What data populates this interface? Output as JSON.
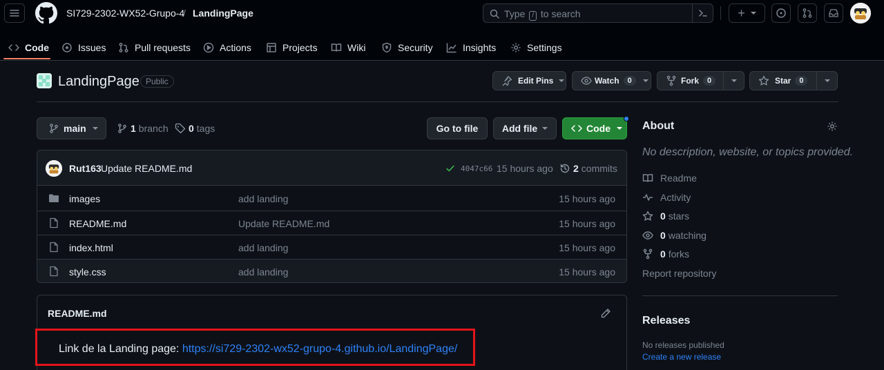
{
  "nav": {
    "org": "SI729-2302-WX52-Grupo-4",
    "separator": "/",
    "repo": "LandingPage",
    "search_prefix": "Type",
    "search_key": "/",
    "search_suffix": "to search",
    "add_symbol": "+"
  },
  "tabs": [
    {
      "label": "Code"
    },
    {
      "label": "Issues"
    },
    {
      "label": "Pull requests"
    },
    {
      "label": "Actions"
    },
    {
      "label": "Projects"
    },
    {
      "label": "Wiki"
    },
    {
      "label": "Security"
    },
    {
      "label": "Insights"
    },
    {
      "label": "Settings"
    }
  ],
  "repo": {
    "name": "LandingPage",
    "visibility": "Public",
    "edit_pins": "Edit Pins",
    "watch": "Watch",
    "watch_count": "0",
    "fork": "Fork",
    "fork_count": "0",
    "star": "Star",
    "star_count": "0"
  },
  "branch": {
    "current": "main",
    "branch_count": "1",
    "branch_label": "branch",
    "tag_count": "0",
    "tag_label": "tags",
    "go_to_file": "Go to file",
    "add_file": "Add file",
    "code": "Code"
  },
  "commit": {
    "author": "Rut163",
    "message": "Update README.md",
    "sha": "4047c66",
    "time": "15 hours ago",
    "count": "2",
    "count_label": "commits"
  },
  "files": [
    {
      "name": "images",
      "type": "folder",
      "message": "add landing",
      "age": "15 hours ago"
    },
    {
      "name": "README.md",
      "type": "file",
      "message": "Update README.md",
      "age": "15 hours ago"
    },
    {
      "name": "index.html",
      "type": "file",
      "message": "add landing",
      "age": "15 hours ago"
    },
    {
      "name": "style.css",
      "type": "file",
      "message": "add landing",
      "age": "15 hours ago"
    }
  ],
  "readme": {
    "title": "README.md",
    "text": "Link de la Landing page: ",
    "link": "https://si729-2302-wx52-grupo-4.github.io/LandingPage/"
  },
  "about": {
    "title": "About",
    "description": "No description, website, or topics provided.",
    "readme": "Readme",
    "activity": "Activity",
    "stars_count": "0",
    "stars_label": "stars",
    "watching_count": "0",
    "watching_label": "watching",
    "forks_count": "0",
    "forks_label": "forks",
    "report": "Report repository"
  },
  "releases": {
    "title": "Releases",
    "none": "No releases published",
    "create": "Create a new release"
  },
  "colors": {
    "background": "#0d1117",
    "header": "#010409",
    "accent_green": "#238636",
    "link_blue": "#2f81f7",
    "tab_underline": "#f78166",
    "annotation_red": "#e3141a"
  }
}
